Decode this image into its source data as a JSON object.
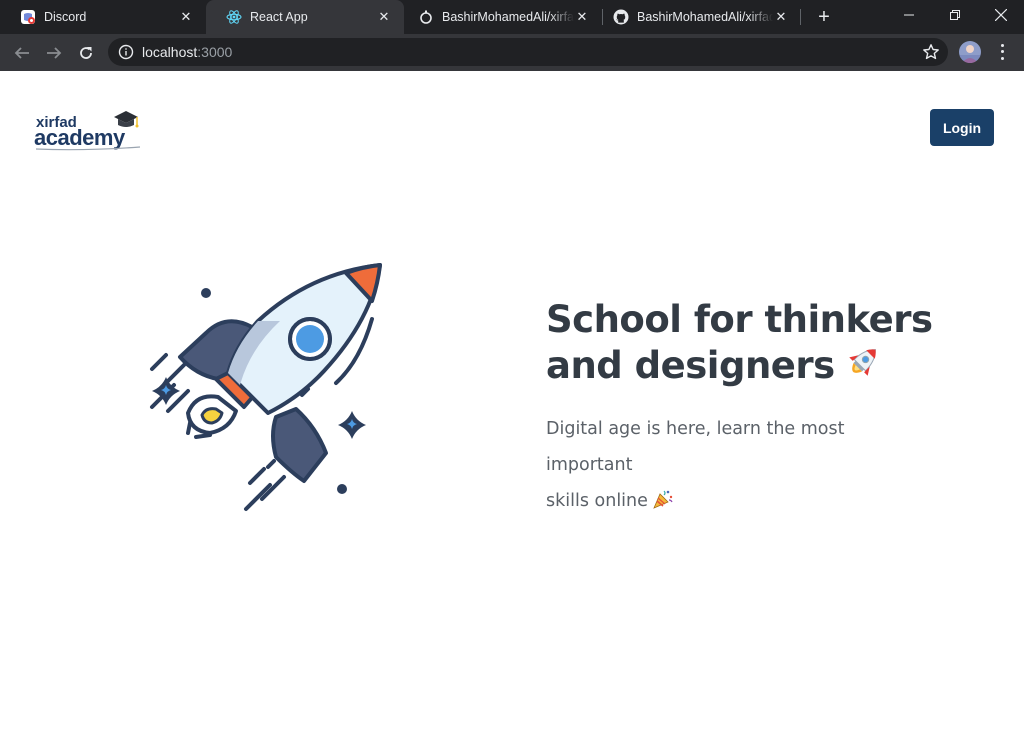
{
  "browser": {
    "tabs": [
      {
        "title": "Discord",
        "icon": "discord-icon"
      },
      {
        "title": "React App",
        "icon": "react-icon",
        "active": true
      },
      {
        "title": "BashirMohamedAli/xirfad",
        "icon": "github-icon"
      },
      {
        "title": "BashirMohamedAli/xirfad",
        "icon": "github-icon"
      }
    ],
    "url_host": "localhost",
    "url_port": ":3000"
  },
  "header": {
    "logo_top": "xirfad",
    "logo_bottom": "academy",
    "login_label": "Login"
  },
  "hero": {
    "title_line1": "School for thinkers",
    "title_line2": "and designers",
    "subtitle_line1": "Digital age is here, learn the most important",
    "subtitle_line2": "skills online"
  },
  "colors": {
    "primary": "#1a4068",
    "heading": "#333b44",
    "body_text": "#5b6168",
    "rocket_body": "#e4f2fb",
    "rocket_outline": "#2c3e5c",
    "rocket_accent": "#ef6c3a",
    "rocket_window": "#4d9be3"
  }
}
